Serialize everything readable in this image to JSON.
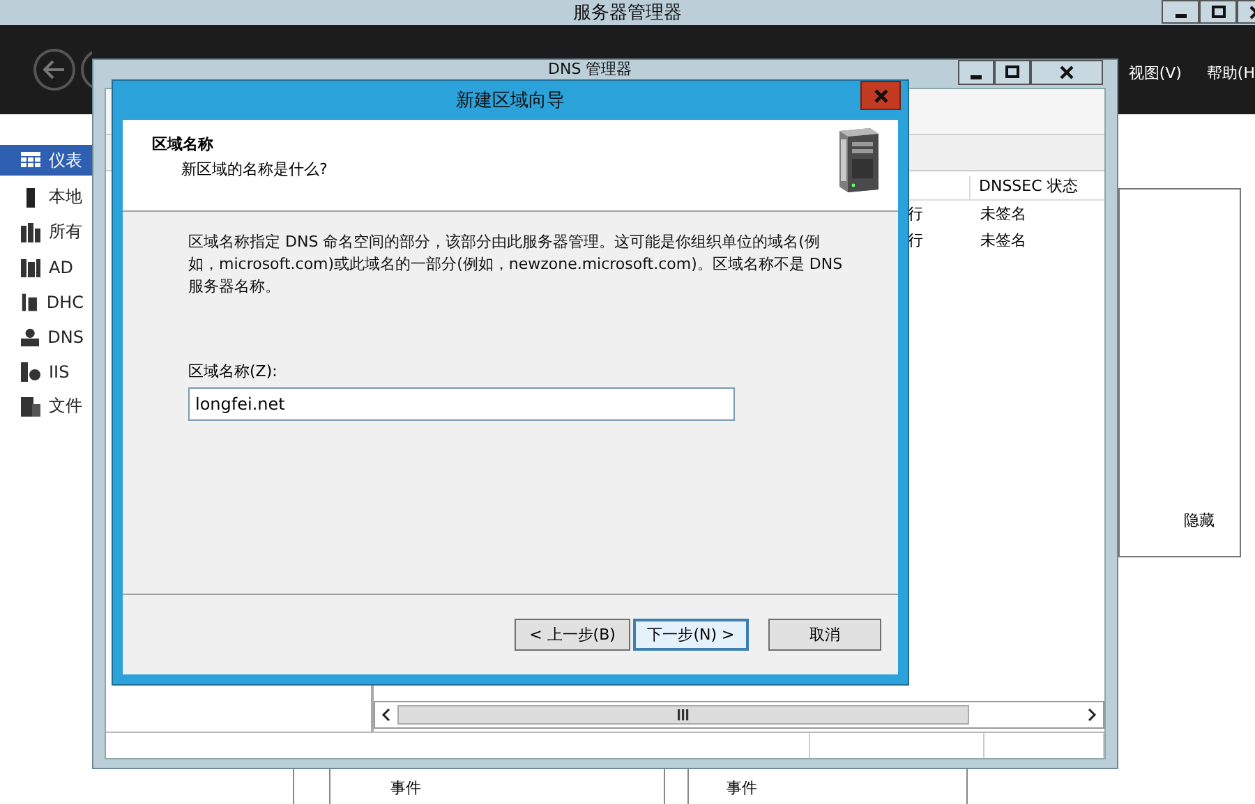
{
  "server_manager": {
    "title": "服务器管理器",
    "menu": [
      {
        "label": "视图(V)"
      },
      {
        "label": "帮助(H"
      }
    ],
    "sidebar": {
      "items": [
        {
          "label": "仪表",
          "selected": true
        },
        {
          "label": "本地",
          "selected": false
        },
        {
          "label": "所有",
          "selected": false
        },
        {
          "label": "AD",
          "selected": false
        },
        {
          "label": "DHC",
          "selected": false
        },
        {
          "label": "DNS",
          "selected": false
        },
        {
          "label": "IIS",
          "selected": false
        },
        {
          "label": "文件",
          "selected": false
        }
      ]
    },
    "hide_label": "隐藏",
    "events": [
      "事件",
      "事件"
    ]
  },
  "dns_manager": {
    "title": "DNS 管理器",
    "columns": [
      {
        "label": "DNSSEC 状态"
      }
    ],
    "rows": [
      {
        "column_1": "行",
        "dnssec": "未签名"
      },
      {
        "column_1": "行",
        "dnssec": "未签名"
      }
    ]
  },
  "wizard": {
    "title": "新建区域向导",
    "heading": "区域名称",
    "subheading": "新区域的名称是什么?",
    "description": "区域名称指定 DNS 命名空间的部分，该部分由此服务器管理。这可能是你组织单位的域名(例如，microsoft.com)或此域名的一部分(例如，newzone.microsoft.com)。区域名称不是 DNS 服务器名称。",
    "field": {
      "label": "区域名称(Z):",
      "value": "longfei.net"
    },
    "buttons": [
      {
        "label": "< 上一步(B)",
        "kind": "nav",
        "focused": false
      },
      {
        "label": "下一步(N) >",
        "kind": "nav",
        "focused": true
      },
      {
        "label": "取消",
        "kind": "cancel",
        "focused": false
      }
    ]
  }
}
